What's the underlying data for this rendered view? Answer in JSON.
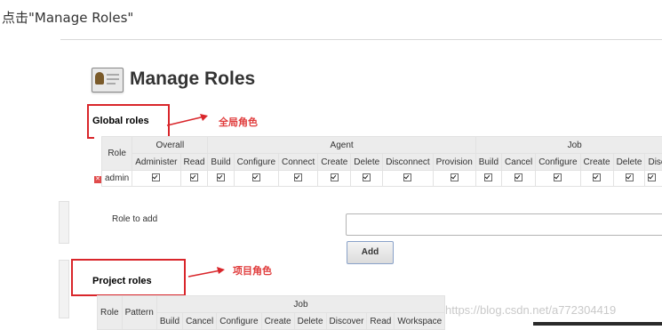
{
  "caption": "点击\"Manage Roles\"",
  "page_title": "Manage Roles",
  "global": {
    "title": "Global roles",
    "annotation": "全局角色",
    "role_header": "Role",
    "groups": [
      "Overall",
      "Agent",
      "Job"
    ],
    "overall_columns": [
      "Administer",
      "Read"
    ],
    "agent_columns": [
      "Build",
      "Configure",
      "Connect",
      "Create",
      "Delete",
      "Disconnect",
      "Provision"
    ],
    "job_columns": [
      "Build",
      "Cancel",
      "Configure",
      "Create",
      "Delete",
      "Disco"
    ],
    "rows": [
      {
        "role": "admin",
        "checked": true
      }
    ]
  },
  "role_to_add": {
    "label": "Role to add",
    "value": "",
    "add_label": "Add"
  },
  "project": {
    "title": "Project roles",
    "annotation": "项目角色",
    "role_header": "Role",
    "pattern_header": "Pattern",
    "group": "Job",
    "columns": [
      "Build",
      "Cancel",
      "Configure",
      "Create",
      "Delete",
      "Discover",
      "Read",
      "Workspace"
    ]
  },
  "watermark": "https://blog.csdn.net/a772304419",
  "colors": {
    "annotation_red": "#d9262b",
    "header_bg": "#ececec"
  },
  "icons": {
    "delete_role": "red-x-icon",
    "title": "roles-id-card-icon"
  }
}
